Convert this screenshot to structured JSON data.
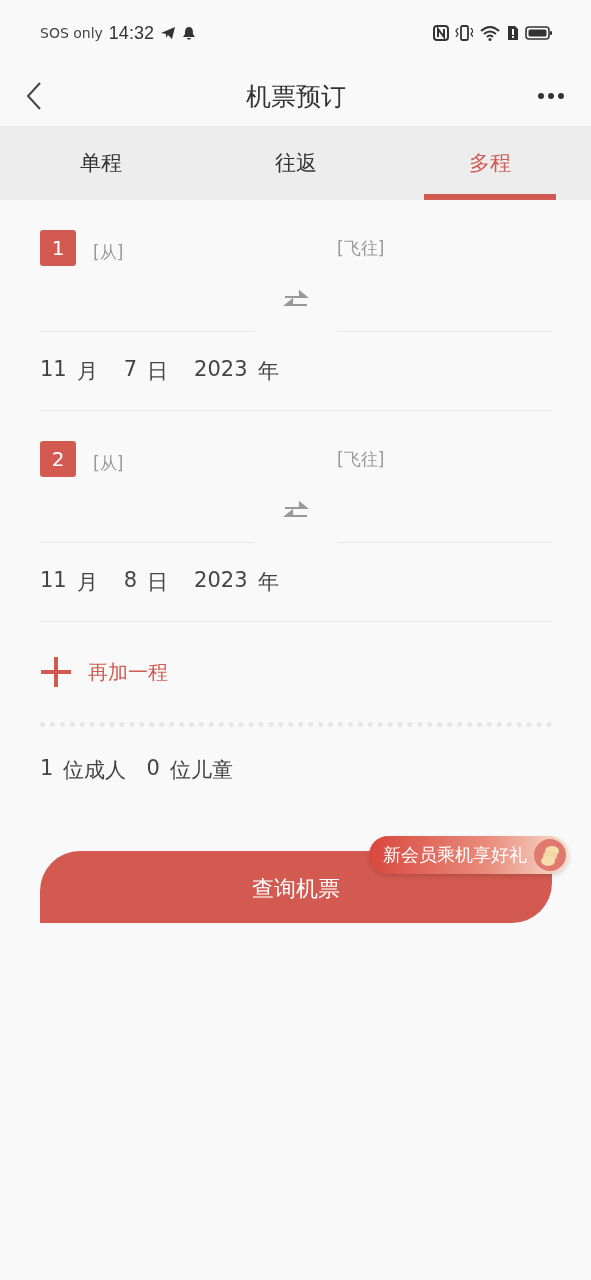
{
  "status_bar": {
    "carrier": "SOS only",
    "time": "14:32"
  },
  "header": {
    "title": "机票预订"
  },
  "tabs": [
    {
      "label": "单程",
      "selected": false
    },
    {
      "label": "往返",
      "selected": false
    },
    {
      "label": "多程",
      "selected": true
    }
  ],
  "legs": [
    {
      "number": "1",
      "from_placeholder": "[从]",
      "to_placeholder": "[飞往]",
      "date": [
        {
          "value": "11",
          "unit": "月"
        },
        {
          "value": "7",
          "unit": "日"
        },
        {
          "value": "2023",
          "unit": "年"
        }
      ]
    },
    {
      "number": "2",
      "from_placeholder": "[从]",
      "to_placeholder": "[飞往]",
      "date": [
        {
          "value": "11",
          "unit": "月"
        },
        {
          "value": "8",
          "unit": "日"
        },
        {
          "value": "2023",
          "unit": "年"
        }
      ]
    }
  ],
  "add_leg": {
    "label": "再加一程"
  },
  "passengers": [
    {
      "count": "1",
      "label": "位成人"
    },
    {
      "count": "0",
      "label": "位儿童"
    }
  ],
  "search_button": {
    "label": "查询机票"
  },
  "promo_badge": {
    "label": "新会员乘机享好礼"
  }
}
